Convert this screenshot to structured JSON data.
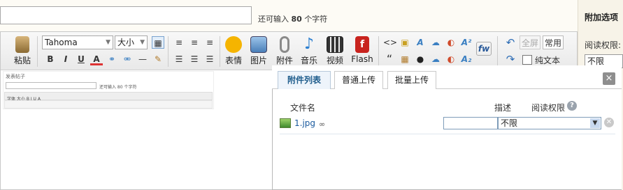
{
  "post": {
    "title_value": "",
    "char_count_prefix": "还可输入",
    "char_count_value": "80",
    "char_count_suffix": "个字符"
  },
  "toolbar": {
    "paste_label": "粘贴",
    "font_name": "Tahoma",
    "font_size": "大小",
    "bold": "B",
    "italic": "I",
    "underline": "U",
    "font_color": "A",
    "big_tools": [
      {
        "label": "表情",
        "icon": "smiley-icon",
        "color": "#f5b400"
      },
      {
        "label": "图片",
        "icon": "image-icon",
        "color": "#4a7fb8"
      },
      {
        "label": "附件",
        "icon": "paperclip-icon",
        "color": "#8a8a8a"
      },
      {
        "label": "音乐",
        "icon": "music-icon",
        "color": "#2c7fd0"
      },
      {
        "label": "视频",
        "icon": "video-icon",
        "color": "#333333"
      },
      {
        "label": "Flash",
        "icon": "flash-icon",
        "color": "#c8231e"
      }
    ],
    "fullscreen_label": "全屏",
    "common_label": "常用",
    "plaintext_label": "纯文本",
    "rich_tools": [
      "<>",
      "🔒",
      "A",
      "☁",
      "◐",
      "A²",
      "fw",
      "“",
      "▦",
      "🐧",
      "☁",
      "◐",
      "A₂"
    ]
  },
  "side_panel": {
    "title": "附加选项",
    "read_permission_label": "阅读权限:",
    "read_permission_value": "不限"
  },
  "attachment_dialog": {
    "tabs": [
      {
        "label": "附件列表",
        "active": true
      },
      {
        "label": "普通上传",
        "active": false
      },
      {
        "label": "批量上传",
        "active": false
      }
    ],
    "close_label": "×",
    "columns": {
      "file_name": "文件名",
      "description": "描述",
      "read_permission": "阅读权限",
      "help": "?"
    },
    "files": [
      {
        "name": "1.jpg",
        "description": "",
        "permission": "不限"
      }
    ]
  },
  "preview_thumbnail": {
    "title": "发表帖子",
    "count_text": "还可输入 80 个字符",
    "toolbar_text": "字体  大小  B I U A"
  }
}
